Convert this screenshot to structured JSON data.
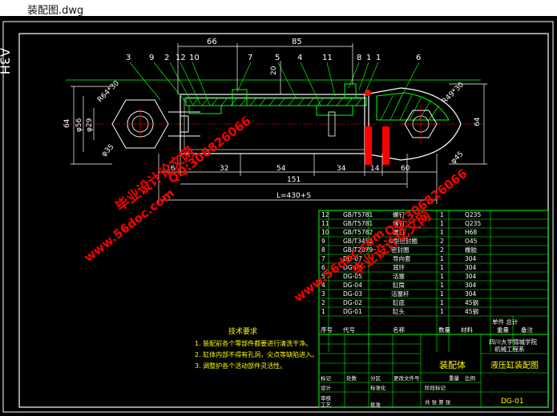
{
  "window": {
    "title": "装配图.dwg"
  },
  "drawing": {
    "sheet_size": "A3H",
    "total_length": "L=430+S",
    "top_dims": [
      "66",
      "85",
      "20"
    ],
    "bottom_dims": [
      "16",
      "32",
      "54",
      "34",
      "14",
      "60"
    ],
    "overall_dim": "151",
    "radius_left": "R64*30",
    "radius_right": "R49*30",
    "dia_56": "φ56",
    "dia_29": "φ29",
    "dia_35": "φ35",
    "height_64_left": "64",
    "height_64_right": "64",
    "dia_right": "φ45",
    "part_numbers": [
      "3",
      "9",
      "2",
      "12",
      "10",
      "7",
      "5",
      "4",
      "11",
      "8",
      "1",
      "1",
      "6"
    ],
    "notes_title": "技术要求",
    "notes": [
      "1. 装配前各个零部件都要进行清洗干净。",
      "2. 缸体内部不得有孔洞，尖点等缺陷进入。",
      "3. 调整护各个活动部件灵活性。"
    ]
  },
  "bom": {
    "rows": [
      {
        "no": "12",
        "code": "GB/T5781",
        "name": "螺钉",
        "qty": "1",
        "mat": "Q235"
      },
      {
        "no": "11",
        "code": "GB/T5781",
        "name": "螺钉",
        "qty": "1",
        "mat": "Q235"
      },
      {
        "no": "10",
        "code": "GB/T5782",
        "name": "螺钉",
        "qty": "1",
        "mat": "H68"
      },
      {
        "no": "9",
        "code": "GB/T3452",
        "name": "O型密封圈",
        "qty": "2",
        "mat": "O45"
      },
      {
        "no": "8",
        "code": "GB/T2879",
        "name": "密封圈",
        "qty": "2",
        "mat": "橡胶"
      },
      {
        "no": "7",
        "code": "DG-07",
        "name": "导向套",
        "qty": "1",
        "mat": "304"
      },
      {
        "no": "6",
        "code": "DG-06",
        "name": "耳环",
        "qty": "1",
        "mat": "304"
      },
      {
        "no": "5",
        "code": "DG-05",
        "name": "活塞",
        "qty": "1",
        "mat": "304"
      },
      {
        "no": "4",
        "code": "DG-04",
        "name": "缸筒",
        "qty": "1",
        "mat": "304"
      },
      {
        "no": "3",
        "code": "DG-03",
        "name": "活塞杆",
        "qty": "1",
        "mat": "304"
      },
      {
        "no": "2",
        "code": "DG-02",
        "name": "缸底",
        "qty": "1",
        "mat": "45钢"
      },
      {
        "no": "1",
        "code": "DG-01",
        "name": "缸头",
        "qty": "1",
        "mat": "45钢"
      }
    ],
    "header": {
      "no": "序号",
      "code": "代号",
      "name": "名称",
      "qty": "数量",
      "mat": "材料",
      "weight": "单件 总计",
      "mass": "重量",
      "remark": "备注"
    }
  },
  "titleblock": {
    "drawing_label": "装配体",
    "school": "四川大学锦城学院",
    "dept": "机械工程系",
    "drawing_name": "液压缸装配图",
    "drawing_no": "DG-01",
    "row_labels": [
      "标记",
      "处数",
      "分区",
      "更改文件号",
      "签名",
      "年月日"
    ],
    "design": "设计",
    "standardize": "标准化",
    "stage": "阶段标记",
    "weight": "重量",
    "ratio": "比例",
    "audit": "审核",
    "process": "工艺",
    "approve": "批准",
    "sheets": "共 张 第 张"
  },
  "watermarks": {
    "cn": "毕业设计论文网",
    "site": "www.56doc.com",
    "qq": "QQ:306826066"
  },
  "colors": {
    "background": "#000000",
    "line_green": "#00ff00",
    "line_white": "#ffffff",
    "dim_cyan": "#00ffff",
    "section_red": "#ff0000",
    "watermark": "#ff0000",
    "part_red": "#ff0000"
  }
}
